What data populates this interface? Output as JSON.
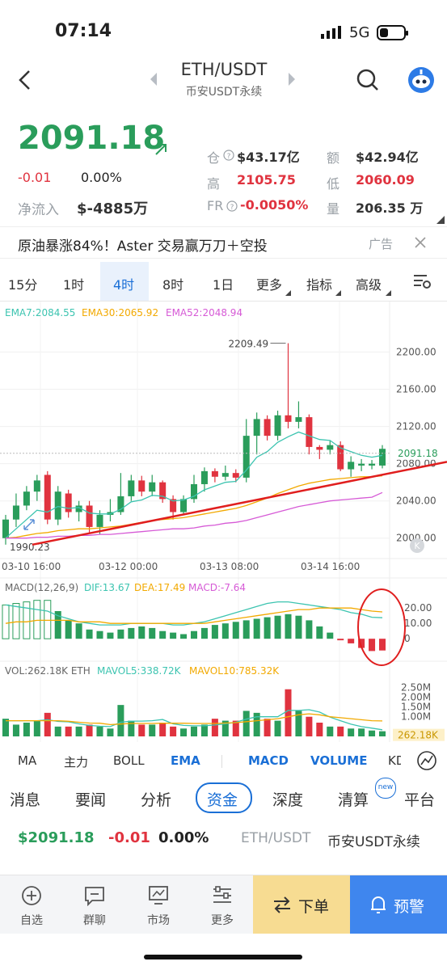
{
  "status": {
    "time": "07:14",
    "network": "5G"
  },
  "header": {
    "pair": "ETH/USDT",
    "subtitle": "币安USDT永续"
  },
  "ticker": {
    "price": "2091.18",
    "change": "-0.01",
    "change_pct": "0.00%",
    "net_inflow_label": "净流入",
    "net_inflow_value": "$-4885万",
    "stats": [
      {
        "label": "仓",
        "value": "$43.17亿"
      },
      {
        "label": "额",
        "value": "$42.94亿"
      },
      {
        "label": "高",
        "value": "2105.75"
      },
      {
        "label": "低",
        "value": "2060.09"
      },
      {
        "label": "FR",
        "value": "-0.0050%"
      },
      {
        "label": "量",
        "value": "206.35 万"
      }
    ]
  },
  "ad": {
    "text": "原油暴涨84%！Aster 交易赢万刀＋空投",
    "tag": "广告"
  },
  "timeframes": [
    "15分",
    "1时",
    "4时",
    "8时",
    "1日",
    "更多",
    "指标",
    "高级"
  ],
  "ema_legend": {
    "ema7": "EMA7:2084.55",
    "ema30": "EMA30:2065.92",
    "ema52": "EMA52:2048.94"
  },
  "chart_data": [
    {
      "type": "candlestick",
      "title": "ETH/USDT 4时",
      "ylim": [
        1985,
        2230
      ],
      "y_ticks": [
        "2200.00",
        "2160.00",
        "2120.00",
        "2080.00",
        "2040.00",
        "2000.00"
      ],
      "x_ticks": [
        "03-10 16:00",
        "03-12 00:00",
        "03-13 08:00",
        "03-14 16:00"
      ],
      "current_price_label": "2091.18",
      "high_label": "2209.49",
      "low_label": "1990.23",
      "candles": [
        [
          2000,
          2020,
          1993,
          2025
        ],
        [
          2020,
          2035,
          2012,
          2048
        ],
        [
          2035,
          2050,
          2030,
          2056
        ],
        [
          2050,
          2062,
          2040,
          2068
        ],
        [
          2068,
          2020,
          2015,
          2072
        ],
        [
          2020,
          2050,
          2014,
          2056
        ],
        [
          2048,
          2028,
          2022,
          2052
        ],
        [
          2028,
          2035,
          2018,
          2040
        ],
        [
          2035,
          2012,
          2005,
          2040
        ],
        [
          2012,
          2025,
          2004,
          2030
        ],
        [
          2025,
          2028,
          2018,
          2042
        ],
        [
          2028,
          2045,
          2025,
          2070
        ],
        [
          2045,
          2062,
          2040,
          2068
        ],
        [
          2062,
          2050,
          2045,
          2067
        ],
        [
          2050,
          2060,
          2045,
          2068
        ],
        [
          2060,
          2042,
          2038,
          2062
        ],
        [
          2042,
          2028,
          2020,
          2046
        ],
        [
          2028,
          2042,
          2025,
          2046
        ],
        [
          2042,
          2058,
          2038,
          2068
        ],
        [
          2058,
          2072,
          2050,
          2076
        ],
        [
          2072,
          2066,
          2060,
          2075
        ],
        [
          2066,
          2070,
          2062,
          2078
        ],
        [
          2070,
          2065,
          2060,
          2074
        ],
        [
          2065,
          2110,
          2060,
          2128
        ],
        [
          2110,
          2128,
          2090,
          2135
        ],
        [
          2128,
          2110,
          2105,
          2132
        ],
        [
          2110,
          2132,
          2105,
          2137
        ],
        [
          2132,
          2125,
          2118,
          2209.49
        ],
        [
          2125,
          2130,
          2118,
          2147
        ],
        [
          2130,
          2098,
          2090,
          2133
        ],
        [
          2098,
          2095,
          2085,
          2100
        ],
        [
          2095,
          2100,
          2090,
          2105
        ],
        [
          2100,
          2074,
          2072,
          2104
        ],
        [
          2074,
          2082,
          2066,
          2088
        ],
        [
          2078,
          2080,
          2072,
          2085
        ],
        [
          2078,
          2080,
          2074,
          2084
        ],
        [
          2078,
          2096,
          2075,
          2100
        ]
      ],
      "ema7": [
        2000,
        2010,
        2020,
        2030,
        2028,
        2034,
        2032,
        2033,
        2027,
        2026,
        2026,
        2031,
        2039,
        2041,
        2046,
        2045,
        2040,
        2041,
        2045,
        2052,
        2056,
        2060,
        2061,
        2073,
        2087,
        2093,
        2103,
        2109,
        2114,
        2110,
        2106,
        2105,
        2097,
        2093,
        2089,
        2087,
        2089
      ],
      "ema30": [
        2000,
        2001,
        2003,
        2005,
        2006,
        2008,
        2009,
        2010,
        2010,
        2011,
        2012,
        2013,
        2015,
        2017,
        2019,
        2020,
        2021,
        2022,
        2024,
        2026,
        2028,
        2030,
        2032,
        2035,
        2039,
        2043,
        2048,
        2052,
        2056,
        2059,
        2061,
        2063,
        2064,
        2065,
        2066,
        2066,
        2067
      ],
      "ema52": [
        2000,
        2000,
        2000,
        2001,
        2001,
        2002,
        2002,
        2003,
        2003,
        2004,
        2004,
        2005,
        2006,
        2007,
        2008,
        2009,
        2010,
        2010,
        2011,
        2013,
        2014,
        2016,
        2017,
        2019,
        2022,
        2025,
        2028,
        2031,
        2034,
        2036,
        2038,
        2040,
        2041,
        2042,
        2043,
        2044,
        2049
      ]
    },
    {
      "type": "bar",
      "title": "MACD(12,26,9)",
      "legend": {
        "dif": "DIF:13.67",
        "dea": "DEA:17.49",
        "macd": "MACD:-7.64"
      },
      "y_ticks": [
        "20.00",
        "10.00",
        "0"
      ],
      "ylim": [
        -12,
        28
      ],
      "hist": [
        22,
        23,
        24,
        25,
        25,
        18,
        12,
        10,
        6,
        5,
        4,
        6,
        7,
        8,
        7,
        5,
        4,
        3,
        5,
        7,
        9,
        10,
        11,
        12,
        13,
        14,
        15,
        16,
        15,
        12,
        8,
        4,
        -1,
        -3,
        -6,
        -8,
        -7.64
      ],
      "dif": [
        22,
        21,
        20,
        19,
        18,
        15,
        13,
        11,
        10,
        9,
        9,
        9,
        10,
        10,
        10,
        10,
        9,
        9,
        10,
        11,
        13,
        15,
        17,
        19,
        21,
        23,
        24,
        24,
        23,
        22,
        21,
        20,
        19,
        17,
        16,
        14,
        13.67
      ],
      "dea": [
        10,
        11,
        11,
        12,
        12,
        12,
        12,
        11,
        11,
        11,
        10,
        10,
        10,
        10,
        10,
        10,
        10,
        10,
        10,
        10,
        11,
        12,
        13,
        14,
        15,
        16,
        17,
        18,
        19,
        19,
        20,
        20,
        20,
        20,
        19,
        18,
        17.49
      ]
    },
    {
      "type": "bar",
      "title": "VOL",
      "legend": {
        "vol": "VOL:262.18K ETH",
        "mavol5": "MAVOL5:338.72K",
        "mavol10": "MAVOL10:785.32K"
      },
      "y_ticks": [
        "2.50M",
        "2.00M",
        "1.50M",
        "1.00M"
      ],
      "current_label": "262.18K",
      "ylim": [
        0,
        2.8
      ],
      "volumes": [
        0.9,
        0.6,
        0.7,
        0.8,
        1.2,
        0.5,
        0.5,
        0.5,
        0.6,
        0.5,
        0.4,
        1.6,
        0.8,
        0.6,
        0.6,
        0.7,
        0.5,
        0.4,
        0.5,
        0.6,
        0.9,
        0.8,
        0.8,
        1.3,
        1.2,
        0.9,
        0.8,
        2.4,
        1.3,
        1.0,
        0.7,
        0.5,
        0.5,
        0.4,
        0.4,
        0.3,
        0.262
      ],
      "mavol5": [
        0.8,
        0.8,
        0.8,
        0.8,
        0.85,
        0.76,
        0.74,
        0.64,
        0.56,
        0.52,
        0.5,
        0.72,
        0.78,
        0.78,
        0.8,
        0.86,
        0.64,
        0.56,
        0.54,
        0.54,
        0.58,
        0.64,
        0.72,
        0.88,
        1.0,
        1.0,
        1.0,
        1.32,
        1.32,
        1.36,
        1.24,
        0.98,
        0.8,
        0.62,
        0.5,
        0.42,
        0.339
      ],
      "mavol10": [
        0.8,
        0.8,
        0.8,
        0.8,
        0.8,
        0.8,
        0.77,
        0.72,
        0.68,
        0.67,
        0.6,
        0.63,
        0.66,
        0.66,
        0.66,
        0.67,
        0.67,
        0.67,
        0.66,
        0.66,
        0.66,
        0.68,
        0.7,
        0.75,
        0.8,
        0.85,
        0.9,
        1.0,
        1.1,
        1.15,
        1.1,
        1.0,
        0.95,
        0.9,
        0.85,
        0.8,
        0.785
      ]
    }
  ],
  "indicator_tabs": [
    "MA",
    "主力",
    "BOLL",
    "EMA",
    "MACD",
    "VOLUME",
    "KD"
  ],
  "section_tabs": [
    "消息",
    "要闻",
    "分析",
    "资金",
    "深度",
    "清算",
    "平台"
  ],
  "new_badge": "new",
  "bottom_ticker": {
    "price": "$2091.18",
    "change": "-0.01",
    "pct": "0.00%",
    "pair": "ETH/USDT",
    "exchange": "币安USDT永续"
  },
  "bottom_nav": {
    "items": [
      "自选",
      "群聊",
      "市场",
      "更多"
    ],
    "order": "下单",
    "alert": "预警"
  },
  "colors": {
    "up": "#2a9d5b",
    "down": "#e0333f",
    "ema7": "#3cc4b0",
    "ema30": "#f2a900",
    "ema52": "#d65ad6",
    "active_tab": "#1a6fd6"
  }
}
